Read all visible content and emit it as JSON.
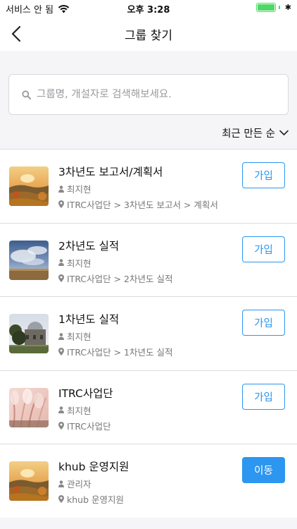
{
  "status_bar": {
    "carrier": "서비스 안 됨",
    "time": "오후 3:28",
    "bluetooth_symbol": "✱"
  },
  "nav": {
    "title": "그룹 찾기",
    "back_icon": "chevron-left-icon"
  },
  "search": {
    "placeholder": "그룹명, 개설자로 검색해보세요.",
    "value": ""
  },
  "sort": {
    "label": "최근 만든 순"
  },
  "groups": [
    {
      "name": "3차년도 보고서/계획서",
      "owner": "최지현",
      "path": "ITRC사업단 > 3차년도 보고서 > 계획서",
      "action": "가입",
      "action_style": "outline",
      "thumbnail": "sunset-landscape"
    },
    {
      "name": "2차년도 실적",
      "owner": "최지현",
      "path": "ITRC사업단 > 2차년도 실적",
      "action": "가입",
      "action_style": "outline",
      "thumbnail": "cloudy-sky"
    },
    {
      "name": "1차년도 실적",
      "owner": "최지현",
      "path": "ITRC사업단 > 1차년도 실적",
      "action": "가입",
      "action_style": "outline",
      "thumbnail": "observatory"
    },
    {
      "name": "ITRC사업단",
      "owner": "최지현",
      "path": "ITRC사업단",
      "action": "가입",
      "action_style": "outline",
      "thumbnail": "pampas-grass"
    },
    {
      "name": "khub 운영지원",
      "owner": "관리자",
      "path": "khub 운영지원",
      "action": "이동",
      "action_style": "filled",
      "thumbnail": "sunset-landscape"
    }
  ],
  "colors": {
    "accent": "#2c96f0",
    "battery": "#4cd964",
    "divider": "#dcdcdf",
    "background": "#f5f5f7"
  }
}
